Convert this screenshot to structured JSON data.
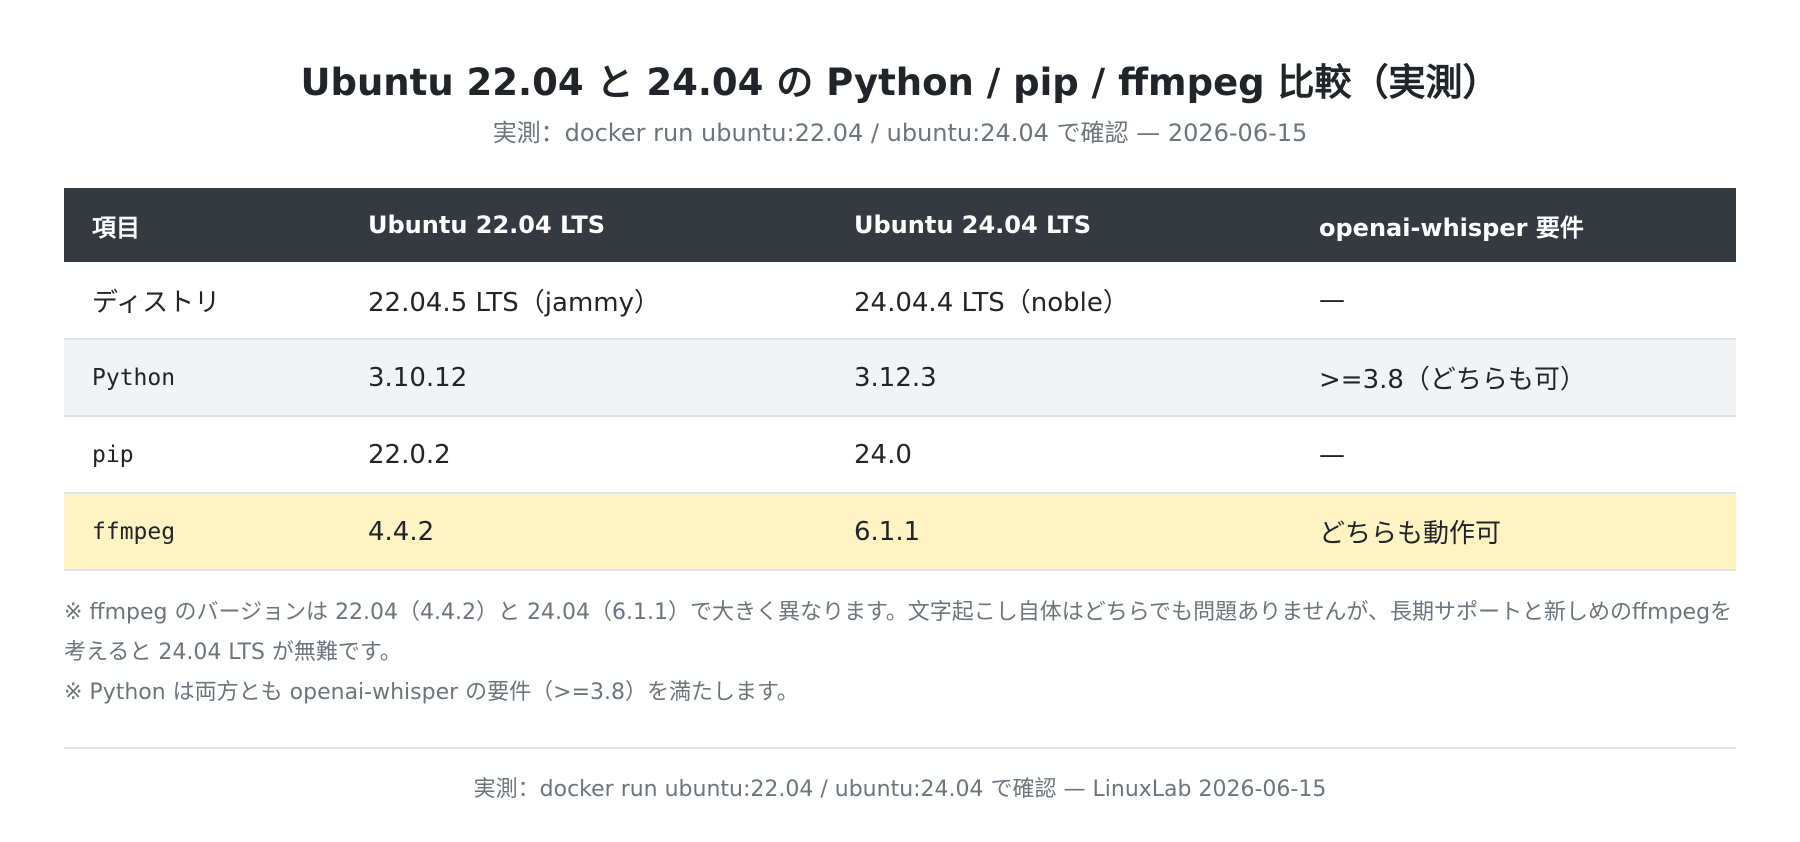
{
  "header": {
    "title": "Ubuntu 22.04 と 24.04 の Python / pip / ffmpeg 比較（実測）",
    "subtitle": "実測：docker run ubuntu:22.04 / ubuntu:24.04 で確認 — 2026-06-15"
  },
  "table": {
    "headers": [
      "項目",
      "Ubuntu 22.04 LTS",
      "Ubuntu 24.04 LTS",
      "openai-whisper 要件"
    ],
    "rows": [
      [
        "ディストリ",
        "22.04.5 LTS（jammy）",
        "24.04.4 LTS（noble）",
        "—"
      ],
      [
        "Python",
        "3.10.12",
        "3.12.3",
        ">=3.8（どちらも可）"
      ],
      [
        "pip",
        "22.0.2",
        "24.0",
        "—"
      ],
      [
        "ffmpeg",
        "4.4.2",
        "6.1.1",
        "どちらも動作可"
      ]
    ],
    "highlight_color": "#fff3c4",
    "header_color": "#343a40"
  },
  "notes": [
    "※ ffmpeg のバージョンは 22.04（4.4.2）と 24.04（6.1.1）で大きく異なります。文字起こし自体はどちらでも問題ありませんが、長期サポートと新しめのffmpegを考えると 24.04 LTS が無難です。",
    "※ Python は両方とも openai-whisper の要件（>=3.8）を満たします。"
  ],
  "footer": {
    "text": "実測：docker run ubuntu:22.04 / ubuntu:24.04 で確認 — LinuxLab 2026-06-15"
  }
}
